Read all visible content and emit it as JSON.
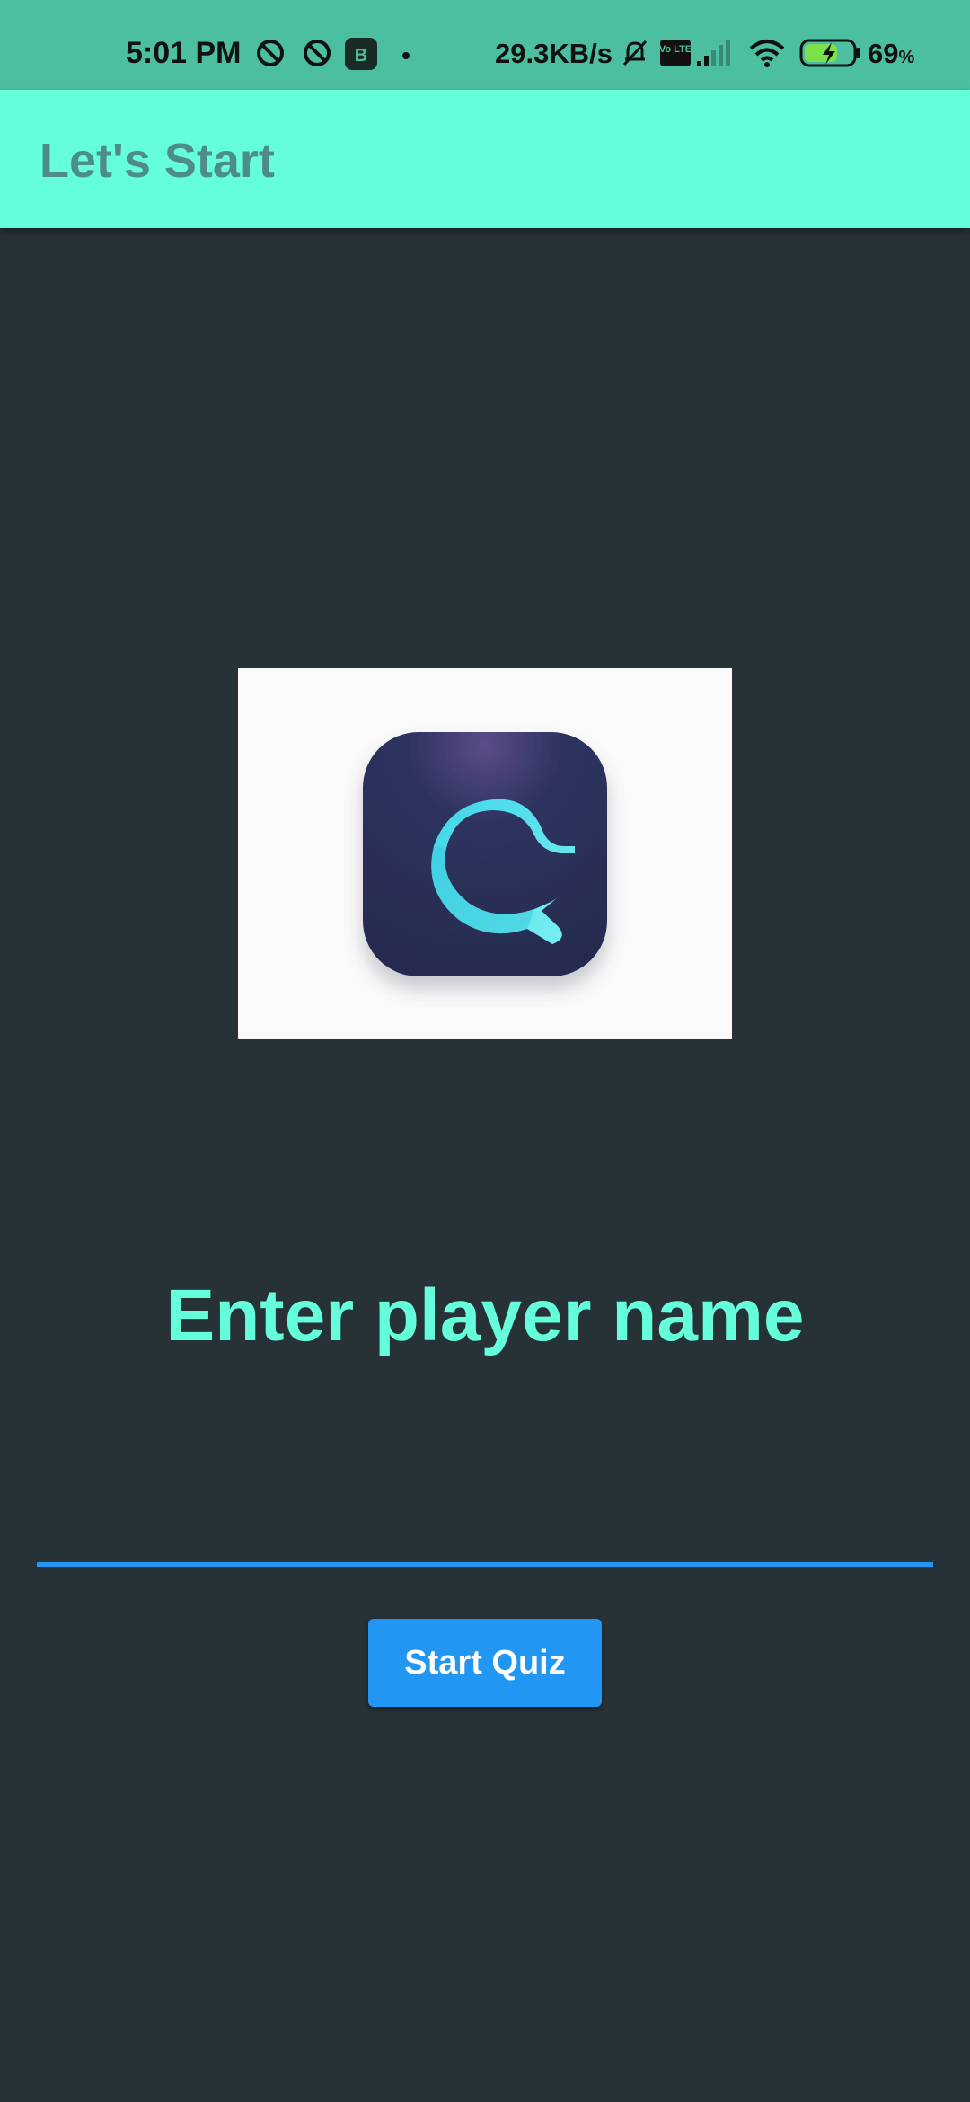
{
  "status_bar": {
    "time": "5:01 PM",
    "network_speed": "29.3KB/s",
    "battery_percent": "69",
    "battery_unit": "%",
    "icons": [
      "location-off-icon",
      "location-off-icon",
      "b-app-icon",
      "notification-dot",
      "mute-bell-icon",
      "volte-icon",
      "cell-signal-icon",
      "wifi-icon",
      "battery-charging-icon"
    ],
    "badge_letter": "B",
    "volte_label": "Vo LTE"
  },
  "app_bar": {
    "title": "Let's Start"
  },
  "logo": {
    "icon": "quiz-logo-icon",
    "colors": {
      "tile": "#2B3156",
      "ribbon": "#4FE6EF"
    }
  },
  "main": {
    "heading": "Enter player name",
    "name_input": {
      "value": "",
      "placeholder": ""
    },
    "start_button_label": "Start Quiz"
  },
  "colors": {
    "status_bar": "#4CBFA0",
    "app_bar": "#64FFDA",
    "app_title": "#4E8C8A",
    "background": "#263238",
    "heading": "#64FFDA",
    "accent": "#2196F3"
  }
}
